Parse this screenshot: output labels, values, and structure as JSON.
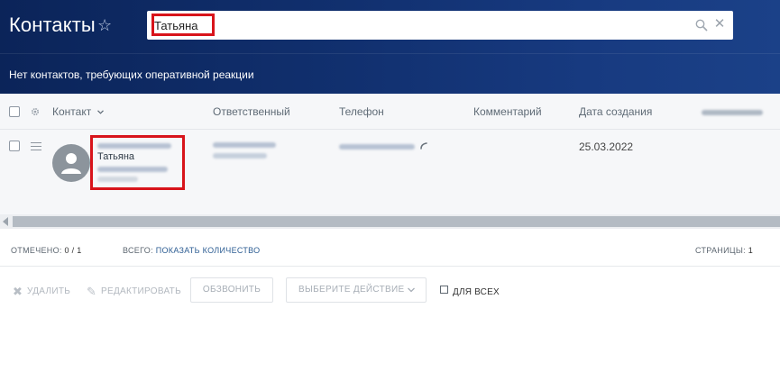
{
  "header": {
    "title": "Контакты",
    "star_icon": "star-outline-icon",
    "search": {
      "value": "Татьяна",
      "search_icon": "search-icon",
      "clear_icon": "close-icon"
    },
    "notice": "Нет контактов, требующих оперативной реакции"
  },
  "table": {
    "columns": [
      "Контакт",
      "Ответственный",
      "Телефон",
      "Комментарий",
      "Дата создания"
    ],
    "contact_sort_icon": "chevron-down-icon",
    "rows": [
      {
        "contact_name": "Татьяна",
        "date_created": "25.03.2022"
      }
    ]
  },
  "footer": {
    "marked_label": "ОТМЕЧЕНО:",
    "marked_value": "0 / 1",
    "total_label": "ВСЕГО:",
    "total_link": "ПОКАЗАТЬ КОЛИЧЕСТВО",
    "pages_label": "СТРАНИЦЫ:",
    "pages_value": "1"
  },
  "actions": {
    "delete": "УДАЛИТЬ",
    "edit": "РЕДАКТИРОВАТЬ",
    "call": "ОБЗВОНИТЬ",
    "choose_action": "ВЫБЕРИТЕ ДЕЙСТВИЕ",
    "for_all": "ДЛЯ ВСЕХ"
  },
  "colors": {
    "header_dark": "#0b2459",
    "header_light": "#1b4188",
    "highlight": "#d8141b",
    "link": "#2d5d93"
  }
}
